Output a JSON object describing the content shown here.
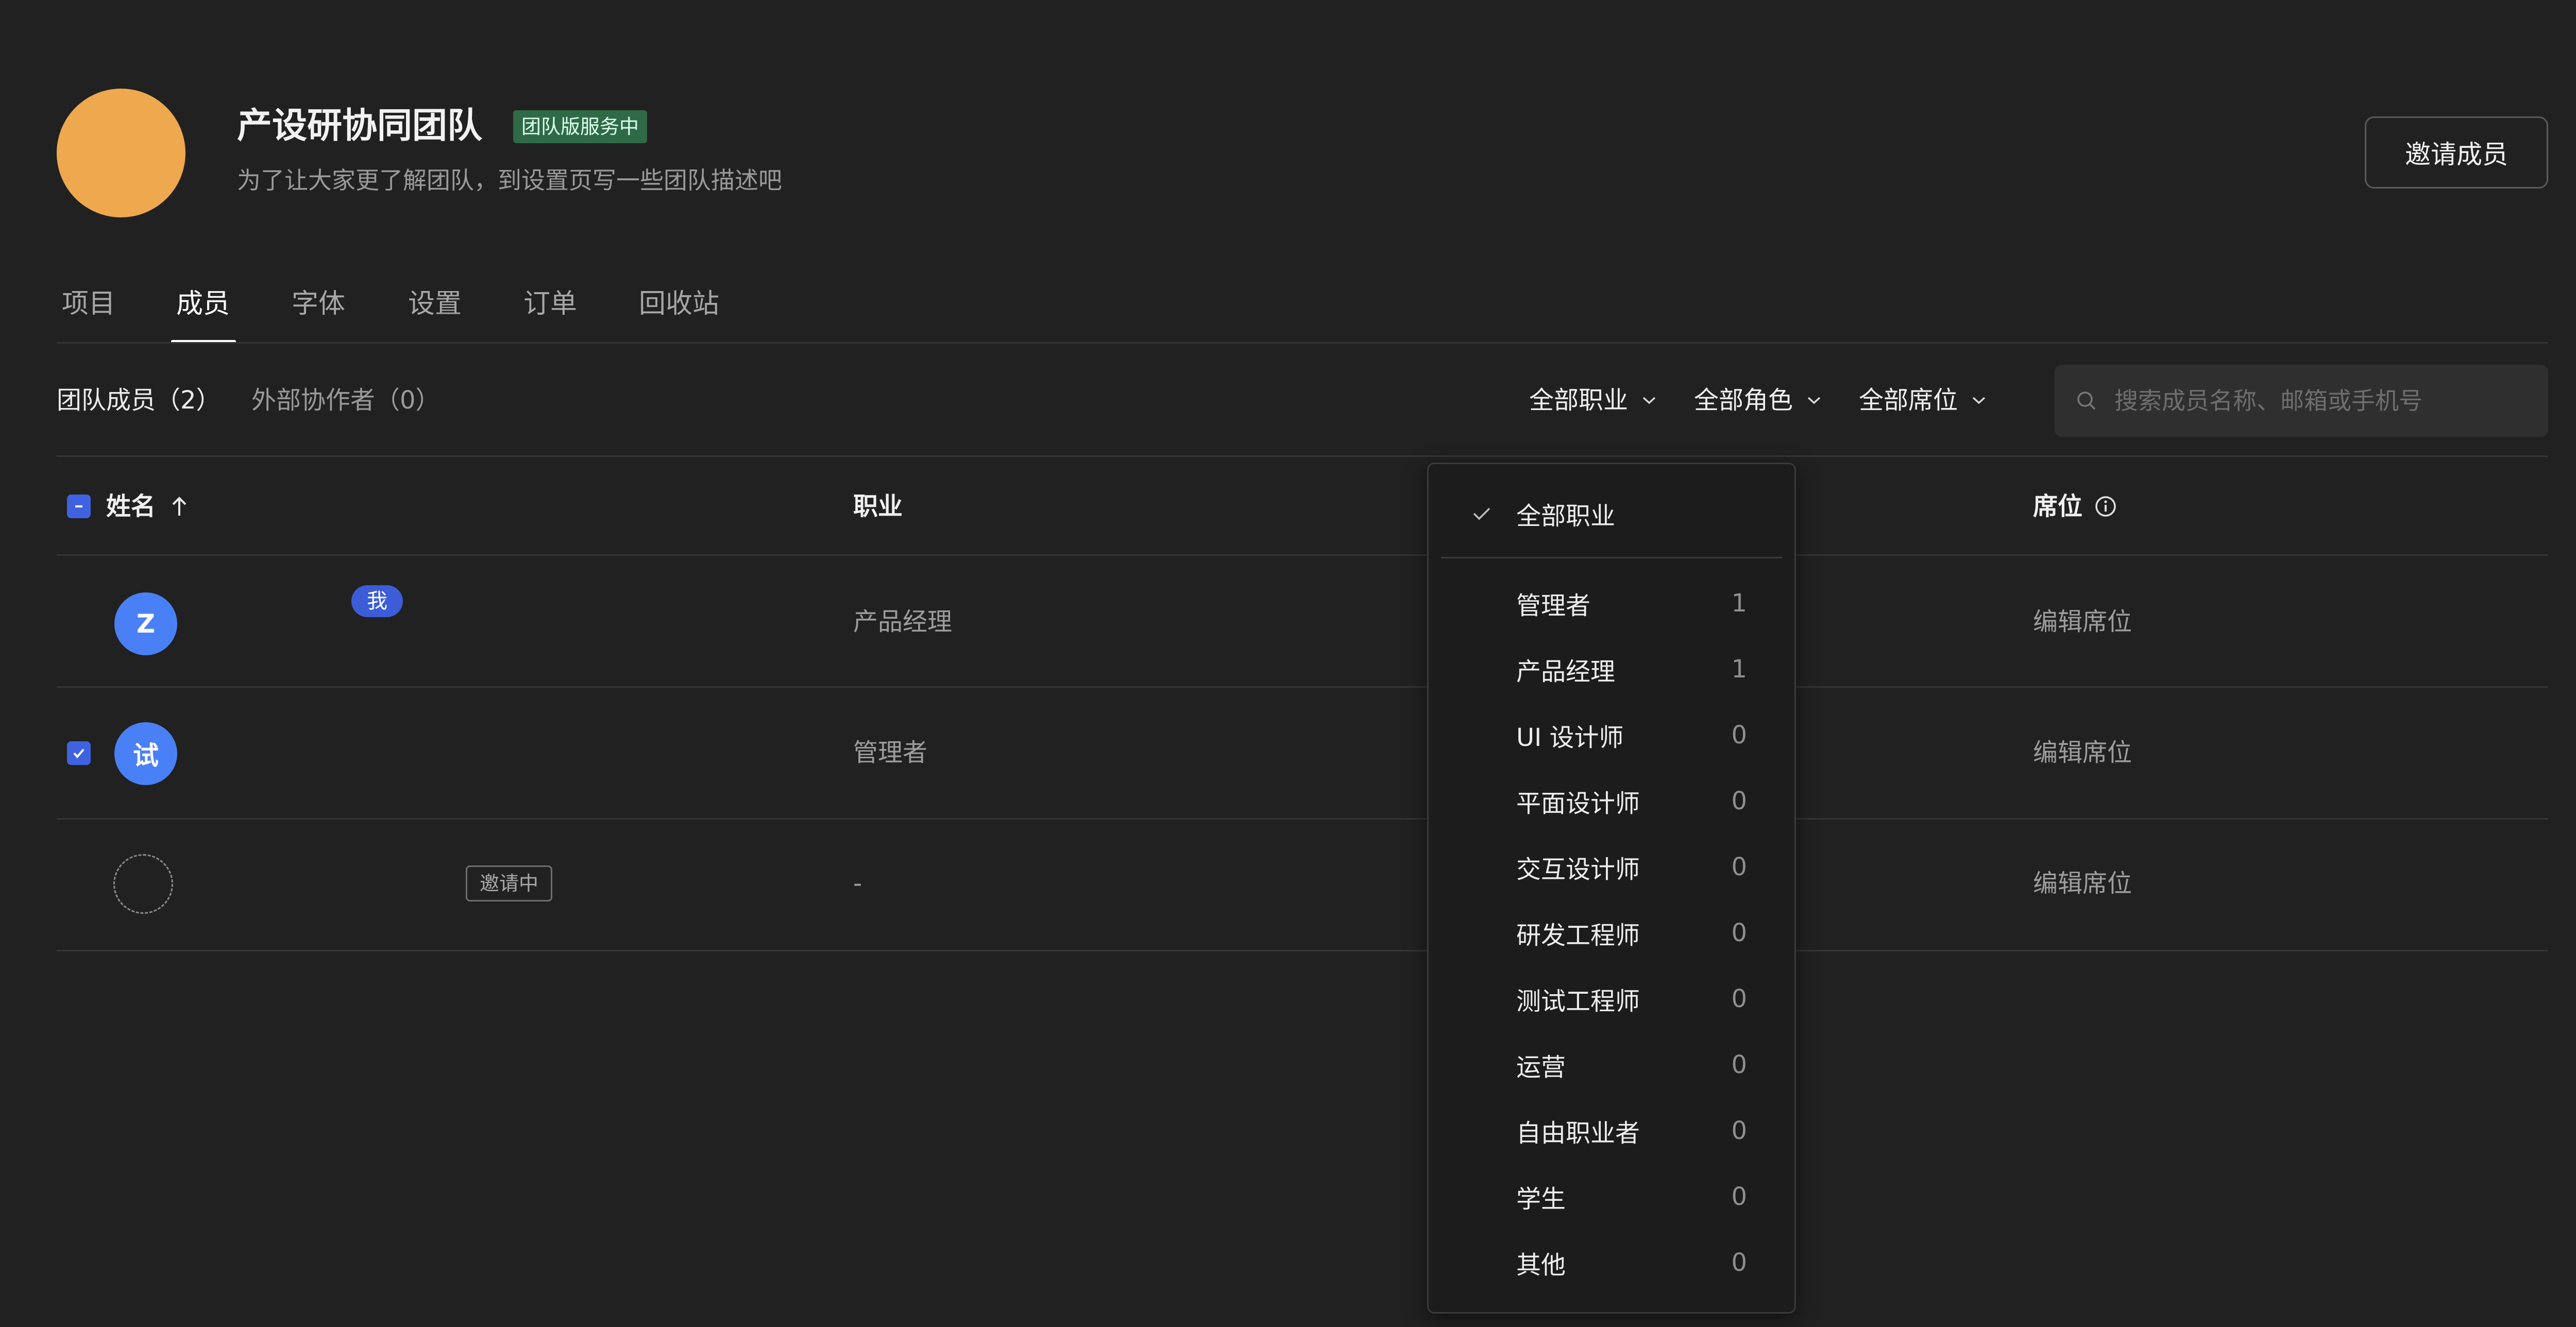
{
  "team": {
    "name": "产设研协同团队",
    "service_badge": "团队版服务中",
    "description": "为了让大家更了解团队，到设置页写一些团队描述吧",
    "invite_button": "邀请成员",
    "avatar_color": "#eea84e"
  },
  "tabs": [
    {
      "label": "项目",
      "active": false
    },
    {
      "label": "成员",
      "active": true
    },
    {
      "label": "字体",
      "active": false
    },
    {
      "label": "设置",
      "active": false
    },
    {
      "label": "订单",
      "active": false
    },
    {
      "label": "回收站",
      "active": false
    }
  ],
  "subtabs": {
    "members": "团队成员（2）",
    "external": "外部协作者（0）"
  },
  "filters": {
    "occupation": "全部职业",
    "role": "全部角色",
    "seat": "全部席位"
  },
  "search": {
    "placeholder": "搜索成员名称、邮箱或手机号",
    "icon": "search-icon"
  },
  "table": {
    "headers": {
      "name": "姓名",
      "occupation": "职业",
      "seat": "席位"
    },
    "rows": [
      {
        "avatar": "Z",
        "badge": "我",
        "occupation": "产品经理",
        "seat_action": "编辑席位",
        "checked": false
      },
      {
        "avatar": "试",
        "badge": "",
        "occupation": "管理者",
        "seat_action": "编辑席位",
        "checked": true
      },
      {
        "avatar": "",
        "badge": "邀请中",
        "occupation": "-",
        "seat_action": "编辑席位",
        "checked": false
      }
    ]
  },
  "dropdown": {
    "selected": "全部职业",
    "items": [
      {
        "label": "管理者",
        "count": "1"
      },
      {
        "label": "产品经理",
        "count": "1"
      },
      {
        "label": "UI 设计师",
        "count": "0"
      },
      {
        "label": "平面设计师",
        "count": "0"
      },
      {
        "label": "交互设计师",
        "count": "0"
      },
      {
        "label": "研发工程师",
        "count": "0"
      },
      {
        "label": "测试工程师",
        "count": "0"
      },
      {
        "label": "运营",
        "count": "0"
      },
      {
        "label": "自由职业者",
        "count": "0"
      },
      {
        "label": "学生",
        "count": "0"
      },
      {
        "label": "其他",
        "count": "0"
      }
    ]
  },
  "colors": {
    "background": "#212121",
    "accent": "#3f63e0",
    "avatar_blue": "#4a80f5",
    "service_green": "#2f6a46"
  }
}
